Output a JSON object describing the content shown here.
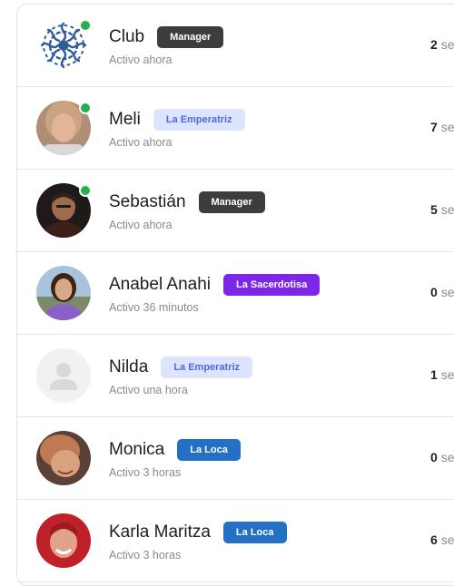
{
  "members": [
    {
      "name": "Club",
      "badge": "Manager",
      "badge_style": "dark",
      "status": "Activo ahora",
      "count": "2",
      "unit": "se",
      "online": true,
      "avatar": "club-logo-icon"
    },
    {
      "name": "Meli",
      "badge": "La Emperatriz",
      "badge_style": "light",
      "status": "Activo ahora",
      "count": "7",
      "unit": "se",
      "online": true,
      "avatar": "profile-photo"
    },
    {
      "name": "Sebastián",
      "badge": "Manager",
      "badge_style": "dark",
      "status": "Activo ahora",
      "count": "5",
      "unit": "se",
      "online": true,
      "avatar": "profile-photo"
    },
    {
      "name": "Anabel Anahi",
      "badge": "La Sacerdotisa",
      "badge_style": "purple",
      "status": "Activo 36 minutos",
      "count": "0",
      "unit": "se",
      "online": false,
      "avatar": "profile-photo"
    },
    {
      "name": "Nilda",
      "badge": "La Emperatriz",
      "badge_style": "light",
      "status": "Activo una hora",
      "count": "1",
      "unit": "se",
      "online": false,
      "avatar": "default-user-icon"
    },
    {
      "name": "Monica",
      "badge": "La Loca",
      "badge_style": "blue",
      "status": "Activo 3 horas",
      "count": "0",
      "unit": "se",
      "online": false,
      "avatar": "profile-photo"
    },
    {
      "name": "Karla Maritza",
      "badge": "La Loca",
      "badge_style": "blue",
      "status": "Activo 3 horas",
      "count": "6",
      "unit": "se",
      "online": false,
      "avatar": "profile-photo"
    }
  ],
  "colors": {
    "online": "#22b14c",
    "badge_dark": "#3d3d3d",
    "badge_light_bg": "#dde4ff",
    "badge_light_text": "#5066e6",
    "badge_purple": "#7c26e6",
    "badge_blue": "#2470c4"
  }
}
